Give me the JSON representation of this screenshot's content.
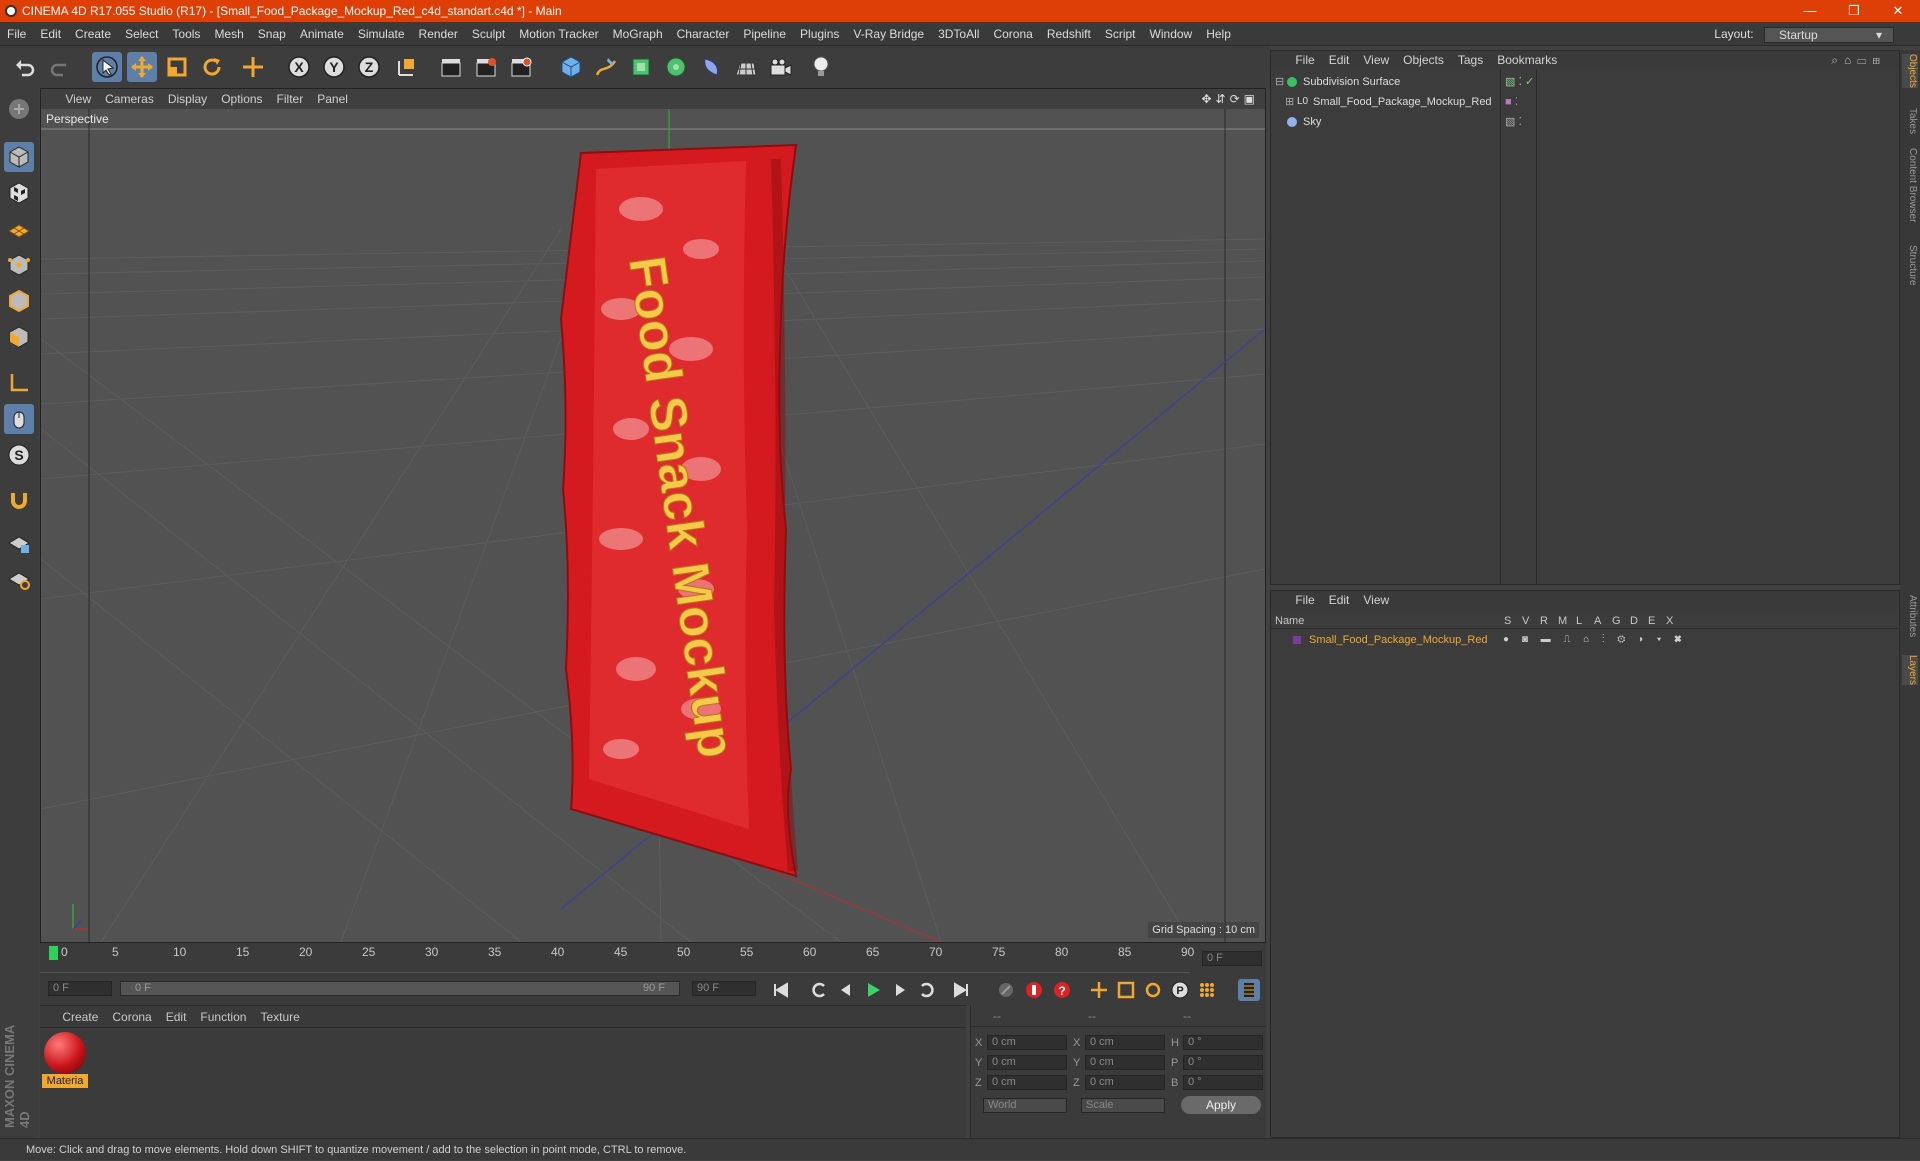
{
  "window": {
    "title": "CINEMA 4D R17.055 Studio (R17) - [Small_Food_Package_Mockup_Red_c4d_standart.c4d *] - Main",
    "minimize": "—",
    "restore": "❐",
    "close": "✕"
  },
  "menu": [
    "File",
    "Edit",
    "Create",
    "Select",
    "Tools",
    "Mesh",
    "Snap",
    "Animate",
    "Simulate",
    "Render",
    "Sculpt",
    "Motion Tracker",
    "MoGraph",
    "Character",
    "Pipeline",
    "Plugins",
    "V-Ray Bridge",
    "3DToAll",
    "Corona",
    "Redshift",
    "Script",
    "Window",
    "Help"
  ],
  "layout": {
    "label": "Layout:",
    "value": "Startup"
  },
  "viewport": {
    "menu": [
      "View",
      "Cameras",
      "Display",
      "Options",
      "Filter",
      "Panel"
    ],
    "label": "Perspective",
    "grid_spacing": "Grid Spacing : 10 cm",
    "package_text": "Food Snack Mockup"
  },
  "timeline": {
    "ticks": [
      "0",
      "5",
      "10",
      "15",
      "20",
      "25",
      "30",
      "35",
      "40",
      "45",
      "50",
      "55",
      "60",
      "65",
      "70",
      "75",
      "80",
      "85",
      "90"
    ],
    "current_frame": "0 F"
  },
  "playback": {
    "start": "0 F",
    "range_start": "0 F",
    "range_end": "90 F",
    "end": "90 F"
  },
  "material": {
    "menu": [
      "Create",
      "Corona",
      "Edit",
      "Function",
      "Texture"
    ],
    "name": "Materia"
  },
  "coords": {
    "header": [
      "--",
      "--",
      "--"
    ],
    "rows": [
      {
        "a": "X",
        "av": "0 cm",
        "b": "X",
        "bv": "0 cm",
        "c": "H",
        "cv": "0 °"
      },
      {
        "a": "Y",
        "av": "0 cm",
        "b": "Y",
        "bv": "0 cm",
        "c": "P",
        "cv": "0 °"
      },
      {
        "a": "Z",
        "av": "0 cm",
        "b": "Z",
        "bv": "0 cm",
        "c": "B",
        "cv": "0 °"
      }
    ],
    "mode": "World",
    "type": "Scale",
    "apply": "Apply"
  },
  "objects": {
    "menu": [
      "File",
      "Edit",
      "View",
      "Objects",
      "Tags",
      "Bookmarks"
    ],
    "items": [
      "Subdivision Surface",
      "Small_Food_Package_Mockup_Red",
      "Sky"
    ]
  },
  "layers": {
    "menu": [
      "File",
      "Edit",
      "View"
    ],
    "name_header": "Name",
    "cols": [
      "S",
      "V",
      "R",
      "M",
      "L",
      "A",
      "G",
      "D",
      "E",
      "X"
    ],
    "item": "Small_Food_Package_Mockup_Red"
  },
  "right_tabs": [
    "Objects",
    "Takes",
    "Content Browser",
    "Structure",
    "Attributes",
    "Layers"
  ],
  "status": "Move: Click and drag to move elements. Hold down SHIFT to quantize movement / add to the selection in point mode, CTRL to remove.",
  "brand": "MAXON CINEMA 4D"
}
